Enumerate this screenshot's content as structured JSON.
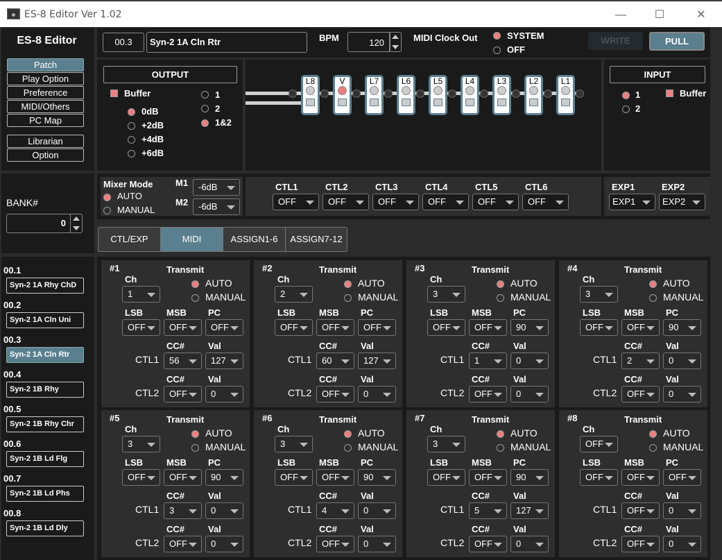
{
  "window": {
    "title": "ES-8 Editor Ver 1.02",
    "minimize": "—",
    "maximize": "☐",
    "close": "✕"
  },
  "nav": {
    "title": "ES-8 Editor",
    "items": [
      {
        "label": "Patch",
        "active": true
      },
      {
        "label": "Play Option"
      },
      {
        "label": "Preference"
      },
      {
        "label": "MIDI/Others"
      },
      {
        "label": "PC Map"
      },
      {
        "label": "Librarian"
      },
      {
        "label": "Option"
      }
    ]
  },
  "header": {
    "patch_number": "00.3",
    "patch_name": "Syn-2 1A Cln Rtr",
    "bpm_label": "BPM",
    "bpm_value": "120",
    "midi_clock_label": "MIDI Clock Out",
    "midi_clock_options": [
      "SYSTEM",
      "OFF"
    ],
    "midi_clock_selected": "SYSTEM",
    "write_label": "WRITE",
    "pull_label": "PULL"
  },
  "output": {
    "title": "OUTPUT",
    "buffer_label": "Buffer",
    "buffer_checked": true,
    "level_options": [
      "0dB",
      "+2dB",
      "+4dB",
      "+6dB"
    ],
    "level_selected": "0dB",
    "out_options": [
      "1",
      "2",
      "1&2"
    ],
    "out_selected": "1&2"
  },
  "chain": {
    "loops": [
      {
        "label": "L8",
        "on": false
      },
      {
        "label": "V",
        "on": true
      },
      {
        "label": "L7",
        "on": false
      },
      {
        "label": "L6",
        "on": false
      },
      {
        "label": "L5",
        "on": false
      },
      {
        "label": "L4",
        "on": false
      },
      {
        "label": "L3",
        "on": false
      },
      {
        "label": "L2",
        "on": false
      },
      {
        "label": "L1",
        "on": false
      }
    ]
  },
  "input": {
    "title": "INPUT",
    "options": [
      "1",
      "2"
    ],
    "selected": "1",
    "buffer_label": "Buffer",
    "buffer_checked": true
  },
  "bank": {
    "label": "BANK#",
    "value": "0"
  },
  "mixer": {
    "title": "Mixer Mode",
    "options": [
      "AUTO",
      "MANUAL"
    ],
    "selected": "AUTO",
    "m1_label": "M1",
    "m1_value": "-6dB",
    "m2_label": "M2",
    "m2_value": "-6dB"
  },
  "ctl": {
    "items": [
      {
        "label": "CTL1",
        "value": "OFF"
      },
      {
        "label": "CTL2",
        "value": "OFF"
      },
      {
        "label": "CTL3",
        "value": "OFF"
      },
      {
        "label": "CTL4",
        "value": "OFF"
      },
      {
        "label": "CTL5",
        "value": "OFF"
      },
      {
        "label": "CTL6",
        "value": "OFF"
      }
    ]
  },
  "exp": {
    "items": [
      {
        "label": "EXP1",
        "value": "EXP1"
      },
      {
        "label": "EXP2",
        "value": "EXP2"
      }
    ]
  },
  "tabs": [
    {
      "label": "CTL/EXP"
    },
    {
      "label": "MIDI",
      "active": true
    },
    {
      "label": "ASSIGN1-6"
    },
    {
      "label": "ASSIGN7-12"
    }
  ],
  "patches": [
    {
      "number": "00.1",
      "name": "Syn-2 1A Rhy ChD"
    },
    {
      "number": "00.2",
      "name": "Syn-2 1A Cln Uni"
    },
    {
      "number": "00.3",
      "name": "Syn-2 1A Cln Rtr",
      "active": true
    },
    {
      "number": "00.4",
      "name": "Syn-2 1B Rhy"
    },
    {
      "number": "00.5",
      "name": "Syn-2 1B Rhy Chr"
    },
    {
      "number": "00.6",
      "name": "Syn-2 1B Ld Flg"
    },
    {
      "number": "00.7",
      "name": "Syn-2 1B Ld Phs"
    },
    {
      "number": "00.8",
      "name": "Syn-2 1B Ld Dly"
    }
  ],
  "midi_labels": {
    "transmit": "Transmit",
    "ch": "Ch",
    "auto": "AUTO",
    "manual": "MANUAL",
    "lsb": "LSB",
    "msb": "MSB",
    "pc": "PC",
    "cc": "CC#",
    "val": "Val",
    "ctl1": "CTL1",
    "ctl2": "CTL2"
  },
  "midi": [
    {
      "id": "#1",
      "ch": "1",
      "transmit": "AUTO",
      "lsb": "OFF",
      "msb": "OFF",
      "pc": "OFF",
      "ctl1_cc": "56",
      "ctl1_val": "127",
      "ctl2_cc": "OFF",
      "ctl2_val": "0"
    },
    {
      "id": "#2",
      "ch": "2",
      "transmit": "AUTO",
      "lsb": "OFF",
      "msb": "OFF",
      "pc": "OFF",
      "ctl1_cc": "60",
      "ctl1_val": "127",
      "ctl2_cc": "OFF",
      "ctl2_val": "0"
    },
    {
      "id": "#3",
      "ch": "3",
      "transmit": "AUTO",
      "lsb": "OFF",
      "msb": "OFF",
      "pc": "90",
      "ctl1_cc": "1",
      "ctl1_val": "0",
      "ctl2_cc": "OFF",
      "ctl2_val": "0"
    },
    {
      "id": "#4",
      "ch": "3",
      "transmit": "AUTO",
      "lsb": "OFF",
      "msb": "OFF",
      "pc": "90",
      "ctl1_cc": "2",
      "ctl1_val": "0",
      "ctl2_cc": "OFF",
      "ctl2_val": "0"
    },
    {
      "id": "#5",
      "ch": "3",
      "transmit": "AUTO",
      "lsb": "OFF",
      "msb": "OFF",
      "pc": "90",
      "ctl1_cc": "3",
      "ctl1_val": "0",
      "ctl2_cc": "OFF",
      "ctl2_val": "0"
    },
    {
      "id": "#6",
      "ch": "3",
      "transmit": "AUTO",
      "lsb": "OFF",
      "msb": "OFF",
      "pc": "90",
      "ctl1_cc": "4",
      "ctl1_val": "0",
      "ctl2_cc": "OFF",
      "ctl2_val": "0"
    },
    {
      "id": "#7",
      "ch": "3",
      "transmit": "AUTO",
      "lsb": "OFF",
      "msb": "OFF",
      "pc": "90",
      "ctl1_cc": "5",
      "ctl1_val": "127",
      "ctl2_cc": "OFF",
      "ctl2_val": "0"
    },
    {
      "id": "#8",
      "ch": "OFF",
      "transmit": "AUTO",
      "lsb": "OFF",
      "msb": "OFF",
      "pc": "OFF",
      "ctl1_cc": "OFF",
      "ctl1_val": "0",
      "ctl2_cc": "OFF",
      "ctl2_val": "0"
    }
  ],
  "colors": {
    "accent": "#5a7f8f",
    "radio_on": "#e98080",
    "background": "#1a1a1a"
  }
}
